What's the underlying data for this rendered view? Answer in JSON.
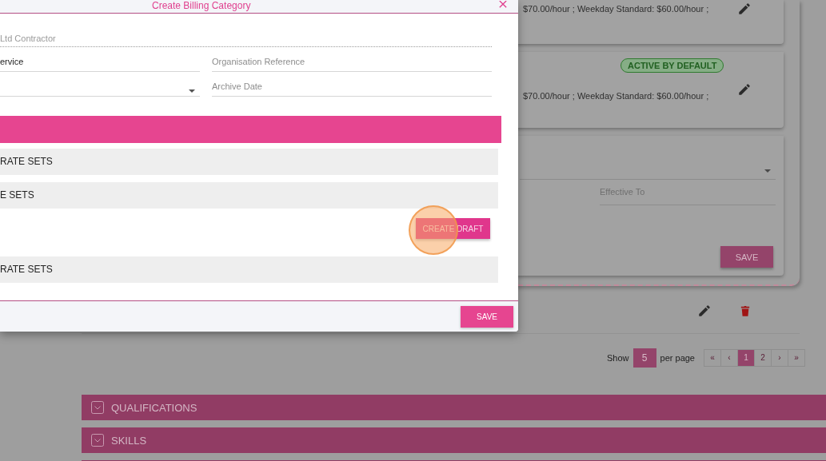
{
  "modal": {
    "title": "Create Billing Category",
    "fields": [
      {
        "kind": "static",
        "value": "Ltd Contractor"
      },
      {
        "kind": "text",
        "value": "ervice"
      },
      {
        "kind": "text",
        "placeholder": "Organisation Reference"
      },
      {
        "kind": "select"
      },
      {
        "kind": "text",
        "placeholder": "Archive Date"
      }
    ],
    "sections": [
      {
        "kind": "header"
      },
      {
        "kind": "row",
        "label": "RATE SETS"
      },
      {
        "kind": "row",
        "label": "E SETS"
      },
      {
        "kind": "action",
        "button": "CREATE DRAFT"
      },
      {
        "kind": "row",
        "label": "RATE SETS"
      }
    ],
    "save_button": "SAVE"
  },
  "background": {
    "cards": [
      {
        "rates": "$70.00/hour ; Weekday Standard: $60.00/hour ;"
      },
      {
        "badge": "ACTIVE BY DEFAULT",
        "rates": "$70.00/hour ; Weekday Standard: $60.00/hour ;"
      }
    ],
    "form": {
      "effective_to_placeholder": "Effective To",
      "save_button": "SAVE"
    },
    "pagination": {
      "show": "Show",
      "per_page_value": "5",
      "per_page": "per page",
      "pages": [
        {
          "label": "«",
          "selected": false
        },
        {
          "label": "‹",
          "selected": false
        },
        {
          "label": "1",
          "selected": true
        },
        {
          "label": "2",
          "selected": false
        },
        {
          "label": "›",
          "selected": false
        },
        {
          "label": "»",
          "selected": false
        }
      ]
    },
    "accordions": [
      {
        "kind": "section",
        "label": "QUALIFICATIONS"
      },
      {
        "kind": "section",
        "label": "SKILLS"
      },
      {
        "kind": "bar"
      }
    ]
  }
}
